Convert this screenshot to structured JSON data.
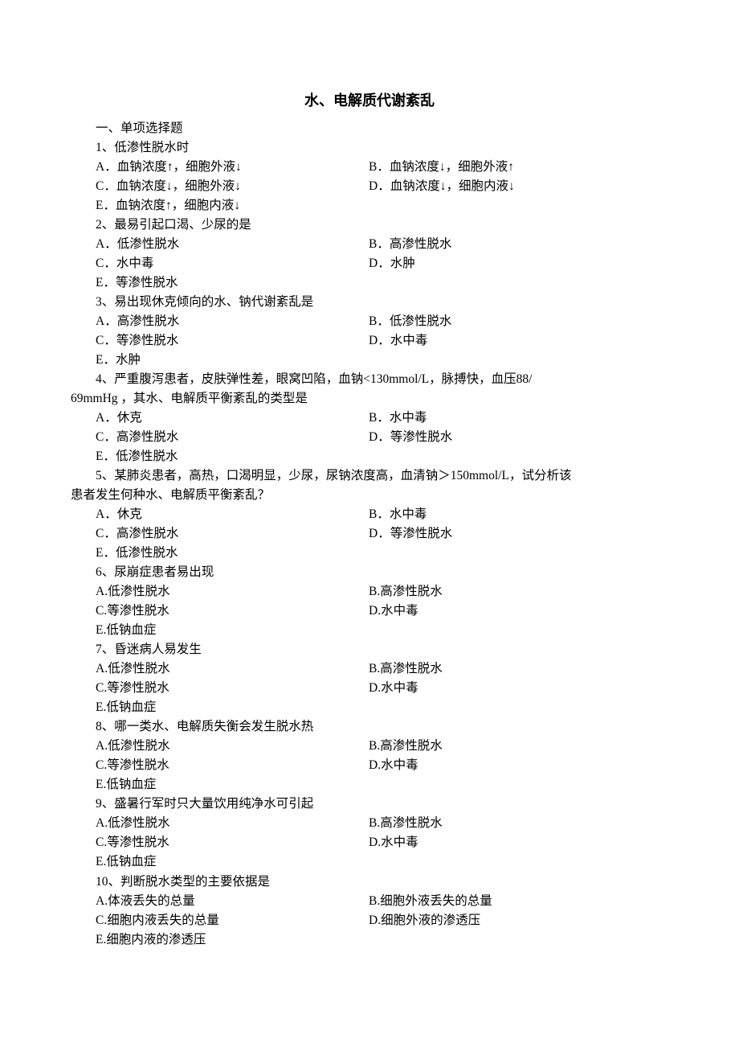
{
  "title": "水、电解质代谢紊乱",
  "section_heading": "一、单项选择题",
  "questions": [
    {
      "stem_lines": [
        "1、低渗性脱水时"
      ],
      "opts": [
        [
          "A．血钠浓度↑，细胞外液↓",
          "B．血钠浓度↓，细胞外液↑"
        ],
        [
          "C．血钠浓度↓，细胞外液↓",
          "D．血钠浓度↓，细胞内液↓"
        ],
        [
          "E．血钠浓度↑，细胞内液↓",
          ""
        ]
      ]
    },
    {
      "stem_lines": [
        "2、最易引起口渴、少尿的是"
      ],
      "opts": [
        [
          "A．低渗性脱水",
          "B．高渗性脱水"
        ],
        [
          "C．水中毒",
          "D．水肿"
        ],
        [
          "E．等渗性脱水",
          ""
        ]
      ]
    },
    {
      "stem_lines": [
        "3、易出现休克倾向的水、钠代谢紊乱是"
      ],
      "opts": [
        [
          "A．高渗性脱水",
          "B．低渗性脱水"
        ],
        [
          "C．等渗性脱水",
          "D．水中毒"
        ],
        [
          "E．水肿",
          ""
        ]
      ]
    },
    {
      "stem_lines": [
        "4、严重腹泻患者，皮肤弹性差，眼窝凹陷，血钠<130mmol/L，脉搏快，血压88/",
        "69mmHg ，其水、电解质平衡紊乱的类型是"
      ],
      "wrap_second_line": true,
      "opts": [
        [
          "A．休克",
          "B．水中毒"
        ],
        [
          "C．高渗性脱水",
          "D．等渗性脱水"
        ],
        [
          "E．低渗性脱水",
          ""
        ]
      ]
    },
    {
      "stem_lines": [
        "5、某肺炎患者，高热，口渴明显，少尿，尿钠浓度高，血清钠＞150mmol/L，试分析该",
        "患者发生何种水、电解质平衡紊乱？"
      ],
      "wrap_second_line": true,
      "opts": [
        [
          "A．休克",
          "B．水中毒"
        ],
        [
          "C．高渗性脱水",
          "D．等渗性脱水"
        ],
        [
          "E．低渗性脱水",
          ""
        ]
      ]
    },
    {
      "stem_lines": [
        "6、尿崩症患者易出现"
      ],
      "opts": [
        [
          "A.低渗性脱水",
          "B.高渗性脱水"
        ],
        [
          "C.等渗性脱水",
          "D.水中毒"
        ],
        [
          "E.低钠血症",
          ""
        ]
      ]
    },
    {
      "stem_lines": [
        "7、昏迷病人易发生"
      ],
      "opts": [
        [
          "A.低渗性脱水",
          "B.高渗性脱水"
        ],
        [
          "C.等渗性脱水",
          "D.水中毒"
        ],
        [
          "E.低钠血症",
          ""
        ]
      ]
    },
    {
      "stem_lines": [
        "8、哪一类水、电解质失衡会发生脱水热"
      ],
      "opts": [
        [
          "A.低渗性脱水",
          "B.高渗性脱水"
        ],
        [
          "C.等渗性脱水",
          "D.水中毒"
        ],
        [
          "E.低钠血症",
          ""
        ]
      ]
    },
    {
      "stem_lines": [
        "9、盛暑行军时只大量饮用纯净水可引起"
      ],
      "opts": [
        [
          "A.低渗性脱水",
          "B.高渗性脱水"
        ],
        [
          "C.等渗性脱水",
          "D.水中毒"
        ],
        [
          "E.低钠血症",
          ""
        ]
      ]
    },
    {
      "stem_lines": [
        "10、判断脱水类型的主要依据是"
      ],
      "opts": [
        [
          "A.体液丢失的总量",
          "B.细胞外液丢失的总量"
        ],
        [
          "C.细胞内液丢失的总量",
          "D.细胞外液的渗透压"
        ],
        [
          "E.细胞内液的渗透压",
          ""
        ]
      ]
    }
  ]
}
